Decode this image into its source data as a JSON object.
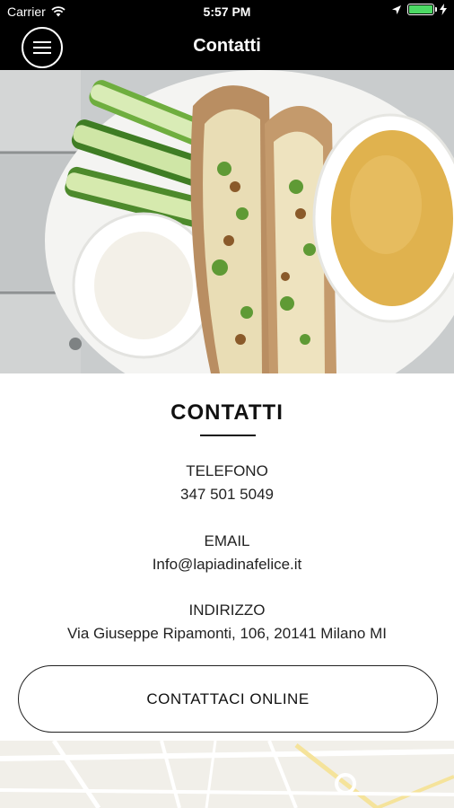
{
  "status_bar": {
    "carrier": "Carrier",
    "time": "5:57 PM",
    "battery_level": 1.0,
    "icons": [
      "wifi-icon",
      "location-arrow-icon",
      "battery-icon",
      "charging-bolt-icon"
    ]
  },
  "nav": {
    "title": "Contatti",
    "menu_icon": "hamburger-menu-icon"
  },
  "hero": {
    "image": "food-photo"
  },
  "contact": {
    "heading": "CONTATTI",
    "phone_label": "TELEFONO",
    "phone_value": "347 501 5049",
    "email_label": "EMAIL",
    "email_value": "Info@lapiadinafelice.it",
    "address_label": "INDIRIZZO",
    "address_value": "Via Giuseppe Ripamonti, 106, 20141 Milano MI",
    "button_label": "CONTATTACI ONLINE"
  },
  "colors": {
    "bar_background": "#000000",
    "battery_fill": "#4cd964",
    "map_background": "#f1efe9"
  }
}
